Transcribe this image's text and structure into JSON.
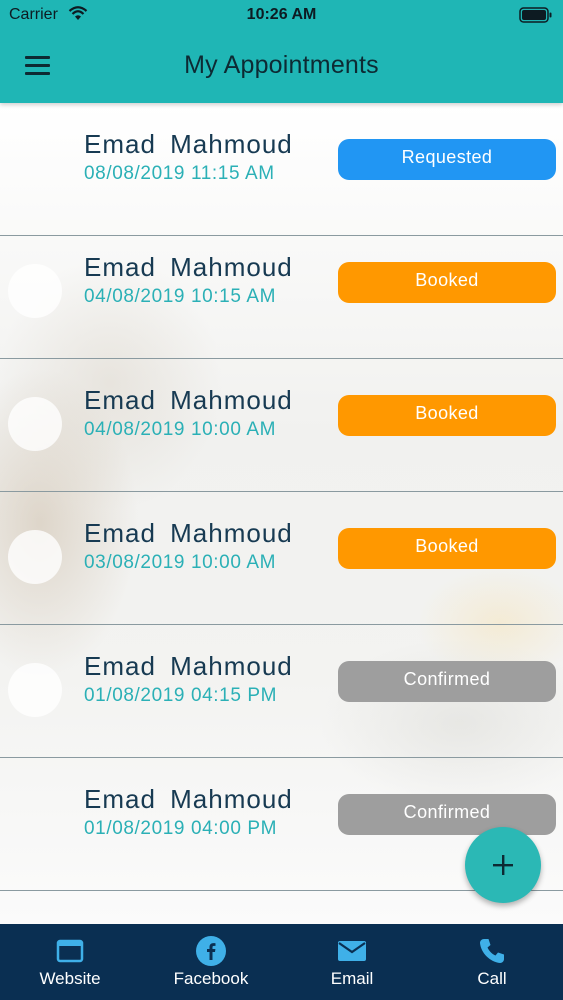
{
  "status_bar": {
    "carrier": "Carrier",
    "time": "10:26 AM"
  },
  "header": {
    "title": "My Appointments",
    "menu_icon": "hamburger-menu-icon"
  },
  "colors": {
    "header": "#1fb6b5",
    "tabbar": "#0a2f52",
    "requested": "#2196f3",
    "booked": "#ff9800",
    "confirmed": "#9e9e9e",
    "fab": "#2bb8b5"
  },
  "appointments": [
    {
      "name": "Emad  Mahmoud",
      "datetime": "08/08/2019 11:15 AM",
      "status": "Requested"
    },
    {
      "name": "Emad  Mahmoud",
      "datetime": "04/08/2019 10:15 AM",
      "status": "Booked"
    },
    {
      "name": "Emad  Mahmoud",
      "datetime": "04/08/2019 10:00 AM",
      "status": "Booked"
    },
    {
      "name": "Emad  Mahmoud",
      "datetime": "03/08/2019 10:00 AM",
      "status": "Booked"
    },
    {
      "name": "Emad  Mahmoud",
      "datetime": "01/08/2019 04:15 PM",
      "status": "Confirmed"
    },
    {
      "name": "Emad  Mahmoud",
      "datetime": "01/08/2019 04:00 PM",
      "status": "Confirmed"
    }
  ],
  "fab": {
    "icon": "plus-icon"
  },
  "tabbar": {
    "items": [
      {
        "label": "Website",
        "icon": "browser-window-icon"
      },
      {
        "label": "Facebook",
        "icon": "facebook-icon"
      },
      {
        "label": "Email",
        "icon": "envelope-icon"
      },
      {
        "label": "Call",
        "icon": "phone-icon"
      }
    ]
  }
}
